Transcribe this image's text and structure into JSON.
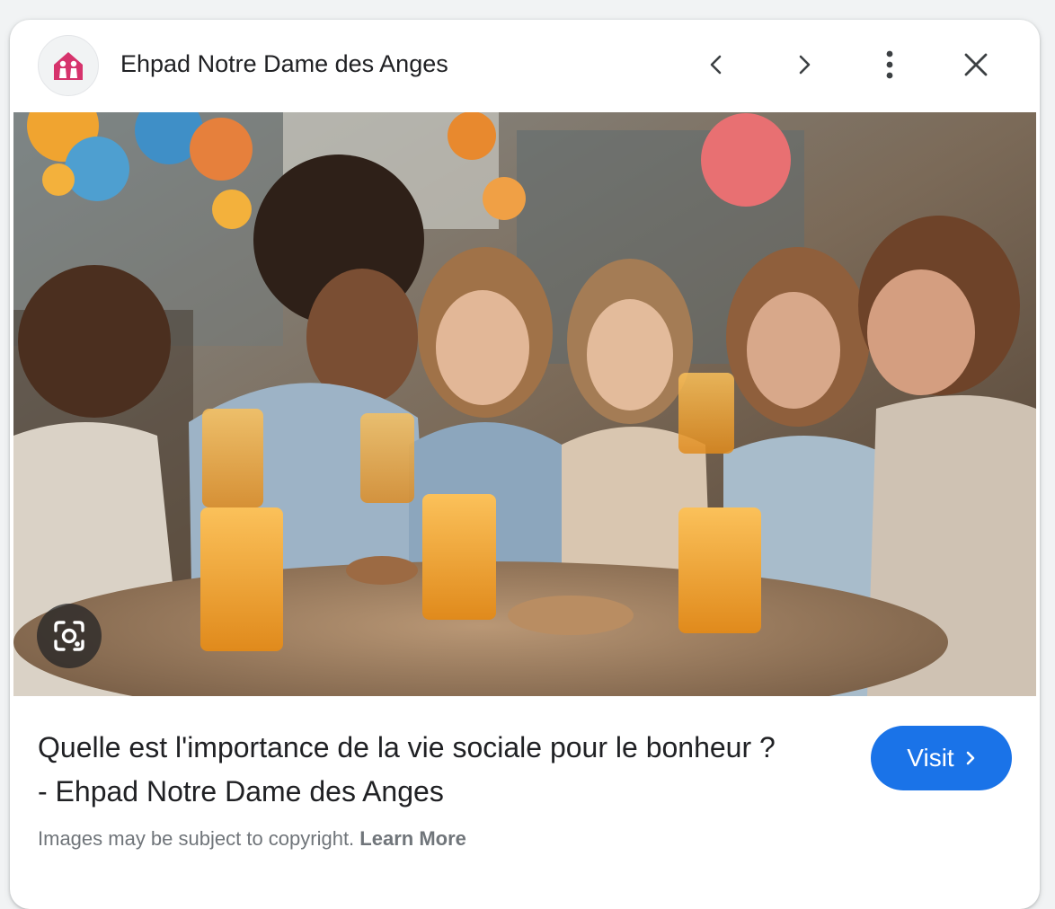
{
  "header": {
    "site_name": "Ehpad Notre Dame des Anges",
    "favicon_icon": "house-people-icon",
    "buttons": {
      "previous": "chevron-left-icon",
      "next": "chevron-right-icon",
      "more": "more-vert-icon",
      "close": "close-icon"
    }
  },
  "image": {
    "lens_icon": "google-lens-icon"
  },
  "result": {
    "title": "Quelle est l'importance de la vie sociale pour le bonheur ? - Ehpad Notre Dame des Anges",
    "visit_label": "Visit"
  },
  "footer": {
    "copyright_text": "Images may be subject to copyright.",
    "learn_more_label": "Learn More"
  },
  "colors": {
    "accent": "#1a73e8",
    "favicon": "#d6336c",
    "text_primary": "#202124",
    "text_secondary": "#70757a"
  }
}
